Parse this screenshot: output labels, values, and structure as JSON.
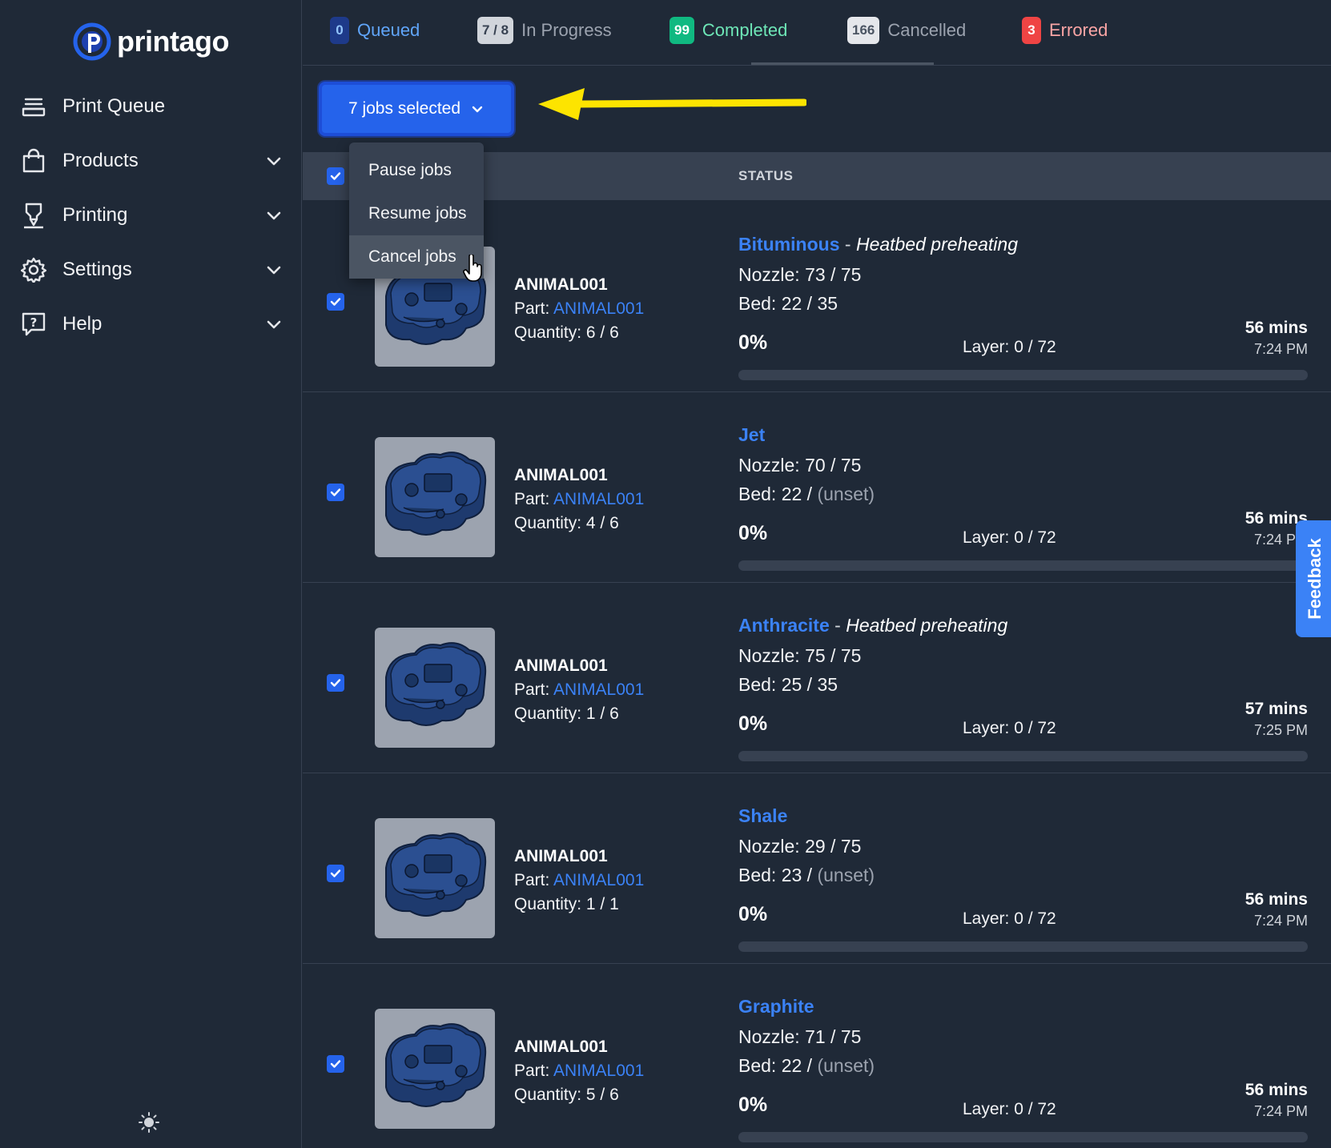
{
  "brand": {
    "name": "printago",
    "accent": "#2563eb"
  },
  "sidebar": {
    "items": [
      {
        "label": "Print Queue",
        "icon": "print-queue-icon",
        "expandable": false
      },
      {
        "label": "Products",
        "icon": "shopping-bag-icon",
        "expandable": true
      },
      {
        "label": "Printing",
        "icon": "printer-icon",
        "expandable": true
      },
      {
        "label": "Settings",
        "icon": "gear-icon",
        "expandable": true
      },
      {
        "label": "Help",
        "icon": "help-icon",
        "expandable": true
      }
    ],
    "theme_icon": "sun-icon"
  },
  "tabs": [
    {
      "badge": "0",
      "label": "Queued",
      "badge_bg": "#1e3a8a",
      "badge_fg": "#93c5fd",
      "label_color": "#60a5fa"
    },
    {
      "badge": "7 / 8",
      "label": "In Progress",
      "badge_bg": "#d1d5db",
      "badge_fg": "#374151",
      "label_color": "#9ca3af",
      "active": true
    },
    {
      "badge": "99",
      "label": "Completed",
      "badge_bg": "#10b981",
      "badge_fg": "#ffffff",
      "label_color": "#6ee7b7"
    },
    {
      "badge": "166",
      "label": "Cancelled",
      "badge_bg": "#e5e7eb",
      "badge_fg": "#4b5563",
      "label_color": "#9ca3af"
    },
    {
      "badge": "3",
      "label": "Errored",
      "badge_bg": "#ef4444",
      "badge_fg": "#ffffff",
      "label_color": "#fca5a5"
    }
  ],
  "bulk": {
    "label": "7 jobs selected",
    "menu": [
      "Pause jobs",
      "Resume jobs",
      "Cancel jobs"
    ],
    "hovered": "Cancel jobs"
  },
  "table": {
    "status_header": "STATUS"
  },
  "jobs": [
    {
      "name": "ANIMAL001",
      "part_label": "Part:",
      "part": "ANIMAL001",
      "qty_label": "Quantity:",
      "qty": "6 / 6",
      "printer": "Bituminous",
      "sep": " - ",
      "state": "Heatbed preheating",
      "nozzle": "Nozzle: 73 / 75",
      "bed_cur": "Bed: 22 / ",
      "bed_target": "35",
      "percent": "0%",
      "progress": 0,
      "layer": "Layer: 0 / 72",
      "eta": "56 mins",
      "clock": "7:24 PM"
    },
    {
      "name": "ANIMAL001",
      "part_label": "Part:",
      "part": "ANIMAL001",
      "qty_label": "Quantity:",
      "qty": "4 / 6",
      "printer": "Jet",
      "sep": "",
      "state": "",
      "nozzle": "Nozzle: 70 / 75",
      "bed_cur": "Bed: 22 / ",
      "bed_target": "(unset)",
      "percent": "0%",
      "progress": 0,
      "layer": "Layer: 0 / 72",
      "eta": "56 mins",
      "clock": "7:24 PM"
    },
    {
      "name": "ANIMAL001",
      "part_label": "Part:",
      "part": "ANIMAL001",
      "qty_label": "Quantity:",
      "qty": "1 / 6",
      "printer": "Anthracite",
      "sep": " - ",
      "state": "Heatbed preheating",
      "nozzle": "Nozzle: 75 / 75",
      "bed_cur": "Bed: 25 / ",
      "bed_target": "35",
      "percent": "0%",
      "progress": 0,
      "layer": "Layer: 0 / 72",
      "eta": "57 mins",
      "clock": "7:25 PM"
    },
    {
      "name": "ANIMAL001",
      "part_label": "Part:",
      "part": "ANIMAL001",
      "qty_label": "Quantity:",
      "qty": "1 / 1",
      "printer": "Shale",
      "sep": "",
      "state": "",
      "nozzle": "Nozzle: 29 / 75",
      "bed_cur": "Bed: 23 / ",
      "bed_target": "(unset)",
      "percent": "0%",
      "progress": 0,
      "layer": "Layer: 0 / 72",
      "eta": "56 mins",
      "clock": "7:24 PM"
    },
    {
      "name": "ANIMAL001",
      "part_label": "Part:",
      "part": "ANIMAL001",
      "qty_label": "Quantity:",
      "qty": "5 / 6",
      "printer": "Graphite",
      "sep": "",
      "state": "",
      "nozzle": "Nozzle: 71 / 75",
      "bed_cur": "Bed: 22 / ",
      "bed_target": "(unset)",
      "percent": "0%",
      "progress": 0,
      "layer": "Layer: 0 / 72",
      "eta": "56 mins",
      "clock": "7:24 PM"
    }
  ],
  "feedback": {
    "label": "Feedback"
  }
}
